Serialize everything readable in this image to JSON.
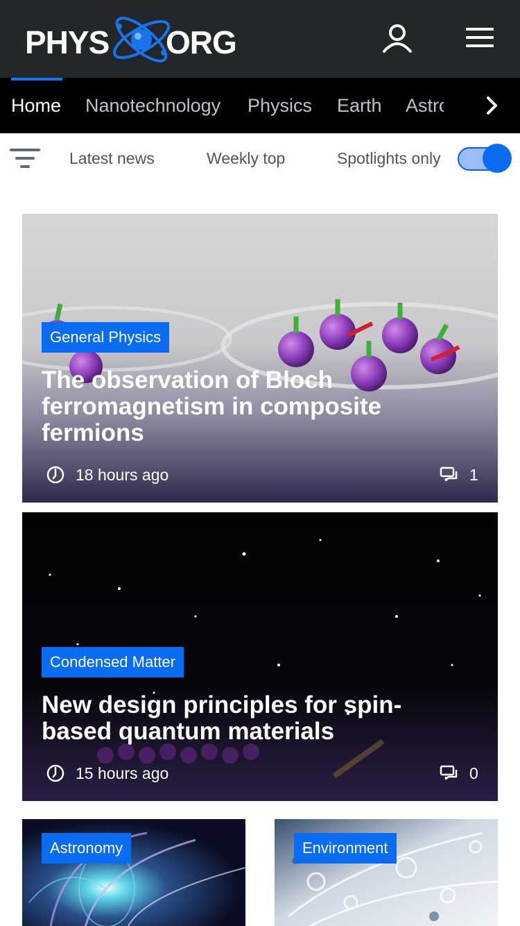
{
  "header": {
    "logo": {
      "left": "PHYS",
      "right": "ORG"
    },
    "user_icon": "user-icon",
    "menu_icon": "hamburger-menu-icon"
  },
  "categories": {
    "items": [
      {
        "label": "Home",
        "active": true
      },
      {
        "label": "Nanotechnology",
        "active": false
      },
      {
        "label": "Physics",
        "active": false
      },
      {
        "label": "Earth",
        "active": false
      },
      {
        "label": "Astronomy",
        "active": false
      }
    ],
    "next_icon": "chevron-right-icon"
  },
  "filters": {
    "filter_icon": "filter-icon",
    "latest": "Latest news",
    "weekly": "Weekly top",
    "spotlights": "Spotlights only",
    "spotlights_on": true
  },
  "articles": [
    {
      "tag": "General Physics",
      "title": "The observation of Bloch ferromagnetism in composite fermions",
      "time": "18 hours ago",
      "comments": "1"
    },
    {
      "tag": "Condensed Matter",
      "title": "New design principles for spin-based quantum materials",
      "time": "15 hours ago",
      "comments": "0"
    },
    {
      "tag": "Astronomy"
    },
    {
      "tag": "Environment"
    }
  ],
  "colors": {
    "header_bg": "#23262b",
    "nav_bg": "#000000",
    "accent": "#0a6cf0"
  }
}
